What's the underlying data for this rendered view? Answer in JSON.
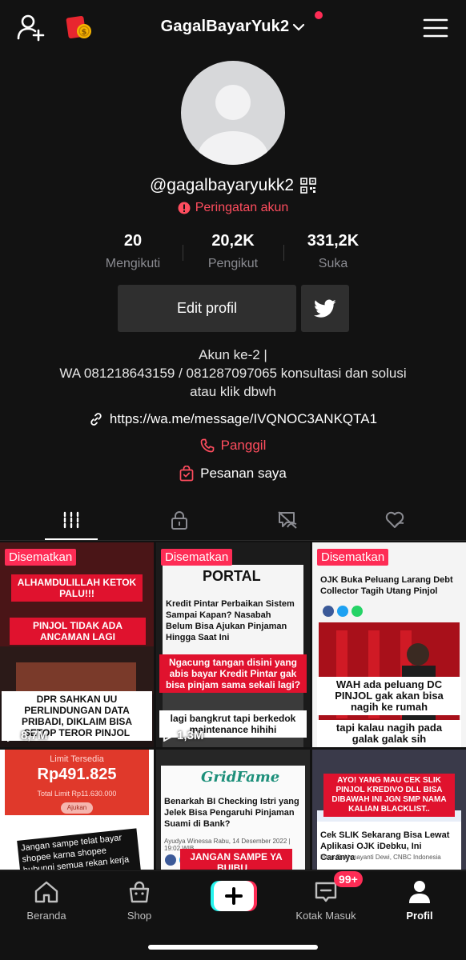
{
  "topbar": {
    "username": "GagalBayarYuk2"
  },
  "profile": {
    "handle": "@gagalbayaryukk2",
    "warning": "Peringatan akun",
    "stats": [
      {
        "value": "20",
        "label": "Mengikuti"
      },
      {
        "value": "20,2K",
        "label": "Pengikut"
      },
      {
        "value": "331,2K",
        "label": "Suka"
      }
    ],
    "edit_label": "Edit profil",
    "bio_lines": [
      "Akun ke-2 |",
      "WA 081218643159 / 081287097065 konsultasi dan solusi",
      "atau klik dbwh"
    ],
    "link": "https://wa.me/message/IVQNOC3ANKQTA1",
    "call": "Panggil",
    "orders": "Pesanan saya"
  },
  "videos": [
    {
      "pinned": "Disematkan",
      "views": "8,7M",
      "tags": [
        "ALHAMDULILLAH KETOK PALU!!!",
        "PINJOL TIDAK ADA ANCAMAN LAGI",
        "DPR SAHKAN UU PERLINDUNGAN DATA PRIBADI, DIKLAIM BISA SETOP TEROR PINJOL"
      ]
    },
    {
      "pinned": "Disematkan",
      "views": "1,3M",
      "brand": "PORTAL",
      "title": "Kredit Pintar Perbaikan Sistem Sampai Kapan? Nasabah Belum Bisa Ajukan Pinjaman Hingga Saat Ini",
      "tags": [
        "Ngacung tangan disini yang abis bayar Kredit Pintar gak bisa pinjam sama sekali lagi?",
        "lagi bangkrut tapi berkedok maintenance hihihi"
      ]
    },
    {
      "pinned": "Disematkan",
      "views": "",
      "title": "OJK Buka Peluang Larang Debt Collector Tagih Utang Pinjol",
      "tags": [
        "WAH ada peluang DC PINJOL gak akan bisa nagih ke rumah",
        "tapi kalau nagih pada galak galak sih"
      ]
    },
    {
      "limit_label": "Limit Tersedia",
      "amount": "Rp491.825",
      "total": "Total Limit Rp11.630.000",
      "button": "Ajukan",
      "tags": [
        "Jangan sampe telat bayar shopee karna shopee hubungi semua rekan kerja dan keluarga..."
      ]
    },
    {
      "brand": "GridFame",
      "title": "Benarkah BI Checking Istri yang Jelek Bisa Pengaruhi Pinjaman Suami di Bank?",
      "byline": "Ayudya Winessa Rabu, 14 Desember 2022 | 19:02 WIB",
      "tags": [
        "JANGAN SAMPE YA BUIBU..."
      ]
    },
    {
      "title": "Cek SLIK Sekarang Bisa Lewat Aplikasi OJK iDebku, Ini Caranya",
      "byline": "Intan Rakhmayanti Dewi, CNBC Indonesia",
      "tags": [
        "AYO! YANG MAU CEK SLIK PINJOL KREDIVO DLL BISA DIBAWAH INI JGN SMP NAMA KALIAN BLACKLIST.."
      ]
    }
  ],
  "nav": [
    {
      "label": "Beranda",
      "icon": "home-icon"
    },
    {
      "label": "Shop",
      "icon": "shop-icon"
    },
    {
      "label": "",
      "icon": "plus-icon"
    },
    {
      "label": "Kotak Masuk",
      "icon": "inbox-icon",
      "badge": "99+"
    },
    {
      "label": "Profil",
      "icon": "profile-icon"
    }
  ],
  "colors": {
    "accent": "#fe2c55",
    "warning": "#ff4d5e",
    "background": "#121212",
    "button": "#2f2f2f"
  }
}
